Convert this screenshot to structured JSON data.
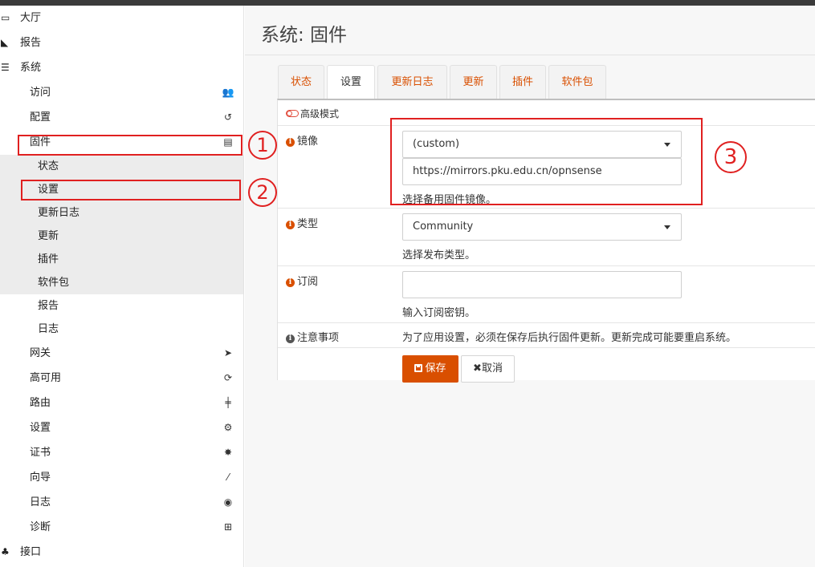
{
  "sidebar": {
    "top_items": {
      "lobby": "大厅",
      "reports": "报告",
      "system": "系统"
    },
    "system_items": [
      {
        "label": "访问",
        "icon": "users-icon",
        "glyph": "👥"
      },
      {
        "label": "配置",
        "icon": "history-icon",
        "glyph": "↺"
      },
      {
        "label": "固件",
        "icon": "hdd-icon",
        "glyph": "▤"
      }
    ],
    "firmware_sub": [
      "状态",
      "设置",
      "更新日志",
      "更新",
      "插件",
      "软件包"
    ],
    "system_items_after": [
      {
        "label": "报告"
      },
      {
        "label": "日志"
      }
    ],
    "other_items": [
      {
        "label": "网关",
        "icon": "location-arrow-icon",
        "glyph": "➤"
      },
      {
        "label": "高可用",
        "icon": "refresh-icon",
        "glyph": "⟳"
      },
      {
        "label": "路由",
        "icon": "signpost-icon",
        "glyph": "╪"
      },
      {
        "label": "设置",
        "icon": "cogs-icon",
        "glyph": "⚙"
      },
      {
        "label": "证书",
        "icon": "certificate-icon",
        "glyph": "✸"
      },
      {
        "label": "向导",
        "icon": "magic-wand-icon",
        "glyph": "⁄"
      },
      {
        "label": "日志",
        "icon": "eye-icon",
        "glyph": "◉"
      },
      {
        "label": "诊断",
        "icon": "medkit-icon",
        "glyph": "⊞"
      }
    ],
    "interfaces": "接口"
  },
  "main": {
    "title": "系统: 固件",
    "tabs": [
      "状态",
      "设置",
      "更新日志",
      "更新",
      "插件",
      "软件包"
    ],
    "active_tab": "设置",
    "advanced_mode": "高级模式",
    "mirror": {
      "label": "镜像",
      "selected": "(custom)",
      "url": "https://mirrors.pku.edu.cn/opnsense",
      "help": "选择备用固件镜像。"
    },
    "type": {
      "label": "类型",
      "selected": "Community",
      "help": "选择发布类型。"
    },
    "subscription": {
      "label": "订阅",
      "value": "",
      "help": "输入订阅密钥。"
    },
    "notice": {
      "label": "注意事项",
      "text": "为了应用设置，必须在保存后执行固件更新。更新完成可能要重启系统。"
    },
    "save_label": "保存",
    "cancel_label": "取消"
  },
  "annotations": [
    "①",
    "②",
    "③"
  ],
  "colors": {
    "accent": "#d94f00",
    "annotation": "#e02020",
    "sidebar_sub_bg": "#ececec",
    "topbar": "#3b3b3b"
  }
}
